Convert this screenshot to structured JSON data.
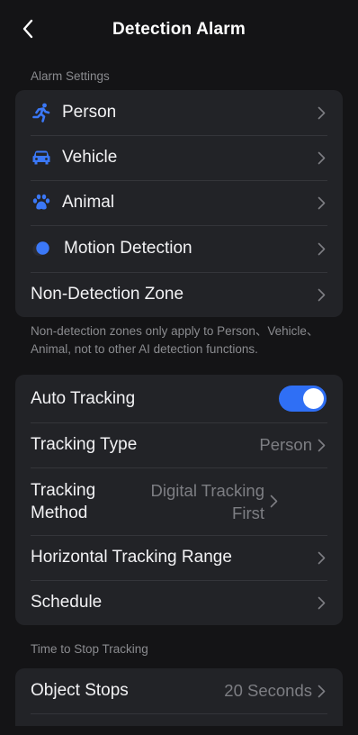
{
  "header": {
    "title": "Detection Alarm"
  },
  "alarm_settings": {
    "section_label": "Alarm Settings",
    "items": [
      {
        "label": "Person",
        "icon": "running-person-icon"
      },
      {
        "label": "Vehicle",
        "icon": "car-icon"
      },
      {
        "label": "Animal",
        "icon": "paw-icon"
      },
      {
        "label": "Motion Detection",
        "icon": "motion-icon"
      },
      {
        "label": "Non-Detection Zone"
      }
    ],
    "note": "Non-detection zones only apply to Person、Vehicle、Animal, not to other AI detection functions."
  },
  "tracking": {
    "auto_tracking_label": "Auto Tracking",
    "auto_tracking_on": true,
    "tracking_type_label": "Tracking Type",
    "tracking_type_value": "Person",
    "tracking_method_label": "Tracking Method",
    "tracking_method_value": "Digital Tracking First",
    "horizontal_range_label": "Horizontal Tracking Range",
    "schedule_label": "Schedule"
  },
  "stop_tracking": {
    "section_label": "Time to Stop Tracking",
    "object_stops_label": "Object Stops",
    "object_stops_value": "20 Seconds"
  },
  "colors": {
    "accent": "#2f6ff5",
    "background": "#141416",
    "card": "#222327"
  }
}
